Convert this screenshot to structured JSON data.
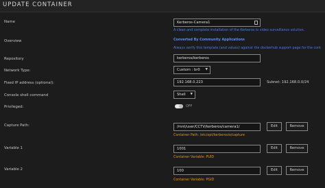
{
  "header": {
    "title": "UPDATE CONTAINER"
  },
  "fields": {
    "name": {
      "label": "Name",
      "value": "Kerberos-Camera1",
      "help": "A clean and complete installation of the Kerberos io video surveillance solution."
    },
    "overview": {
      "label": "Overview",
      "title": "Converted By Community Applications",
      "note": "Always verify this template (and values) against the dockerhub support page for the cont"
    },
    "repository": {
      "label": "Repository",
      "value": "kerberos/kerberos"
    },
    "network_type": {
      "label": "Network Type:",
      "value": "Custom : br0"
    },
    "fixed_ip": {
      "label": "Fixed IP address (optional):",
      "value": "192.168.0.223",
      "subnet": "Subnet: 192.168.0.0/24"
    },
    "console_shell": {
      "label": "Console shell command",
      "value": "Shell"
    },
    "privileged": {
      "label": "Privileged:",
      "toggle_state": "OFF"
    },
    "capture_path": {
      "label": "Capture Path:",
      "value": "/mnt/user/CCTV/kerberos/camera1/",
      "container_path": "Container Path: /etc/opt/kerberosio/capture",
      "edit": "Edit",
      "remove": "Remove"
    },
    "variable1": {
      "label": "Variable 1",
      "value": "1001",
      "container_var": "Container Variable: PUID",
      "edit": "Edit",
      "remove": "Remove"
    },
    "variable2": {
      "label": "Variable 2",
      "value": "100",
      "container_var": "Container Variable: PGID",
      "edit": "Edit",
      "remove": "Remove"
    }
  },
  "colors": {
    "link_blue": "#4d7fd8",
    "orange": "#f0921a",
    "background": "#1c1c1c"
  }
}
